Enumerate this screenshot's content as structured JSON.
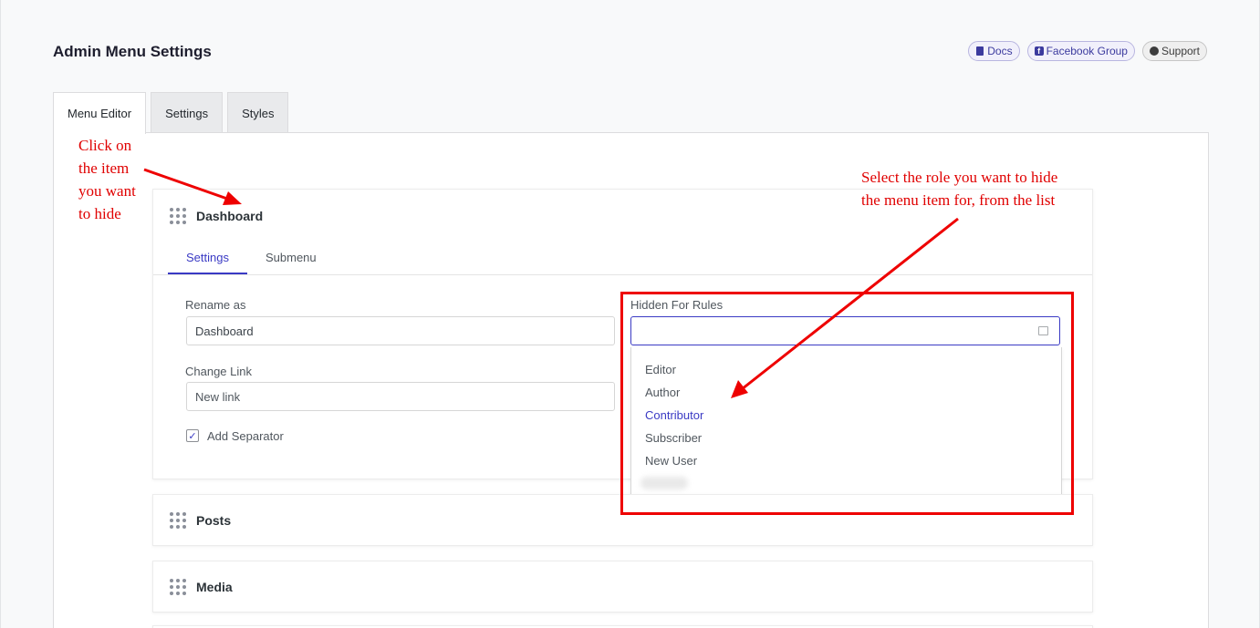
{
  "header": {
    "title": "Admin Menu Settings",
    "links": {
      "docs": "Docs",
      "facebook": "Facebook Group",
      "support": "Support"
    }
  },
  "tabs": {
    "menu_editor": "Menu Editor",
    "settings": "Settings",
    "styles": "Styles"
  },
  "menu_items": {
    "dashboard": {
      "title": "Dashboard",
      "sub_tabs": {
        "settings": "Settings",
        "submenu": "Submenu"
      },
      "rename_label": "Rename as",
      "rename_value": "Dashboard",
      "link_label": "Change Link",
      "link_placeholder": "New link",
      "separator_label": "Add Separator",
      "separator_checked": true,
      "hidden_label": "Hidden For Rules",
      "hidden_value": "",
      "role_options": [
        "Editor",
        "Author",
        "Contributor",
        "Subscriber",
        "New User"
      ],
      "highlighted_role": "Contributor"
    },
    "posts": {
      "title": "Posts"
    },
    "media": {
      "title": "Media"
    }
  },
  "annotations": {
    "click_hint": [
      "Click on",
      "the item",
      "you want",
      "to hide"
    ],
    "select_hint": [
      "Select the role you want to hide",
      "the menu item for, from the list"
    ]
  },
  "colors": {
    "accent": "#3a3ac4",
    "annotation": "#e00000"
  }
}
